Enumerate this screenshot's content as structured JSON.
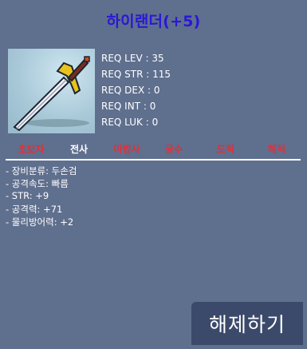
{
  "item": {
    "name": "하이랜더(+5)",
    "name_color": "#2a17d6"
  },
  "requirements": [
    "REQ LEV : 35",
    "REQ STR : 115",
    "REQ DEX : 0",
    "REQ INT : 0",
    "REQ LUK : 0"
  ],
  "jobs": [
    {
      "label": "초보자",
      "color": "#e0303a"
    },
    {
      "label": "전사",
      "color": "#ffffff"
    },
    {
      "label": "마법사",
      "color": "#e0303a"
    },
    {
      "label": "궁수",
      "color": "#e0303a"
    },
    {
      "label": "도적",
      "color": "#e0303a"
    },
    {
      "label": "해적",
      "color": "#e0303a"
    }
  ],
  "stats": [
    "- 장비분류: 두손검",
    "- 공격속도: 빠름",
    "- STR: +9",
    "- 공격력: +71",
    "- 물리방어력: +2"
  ],
  "actions": {
    "unseal_label": "해제하기"
  },
  "icons": {
    "item_icon": "two-handed-sword-icon"
  }
}
